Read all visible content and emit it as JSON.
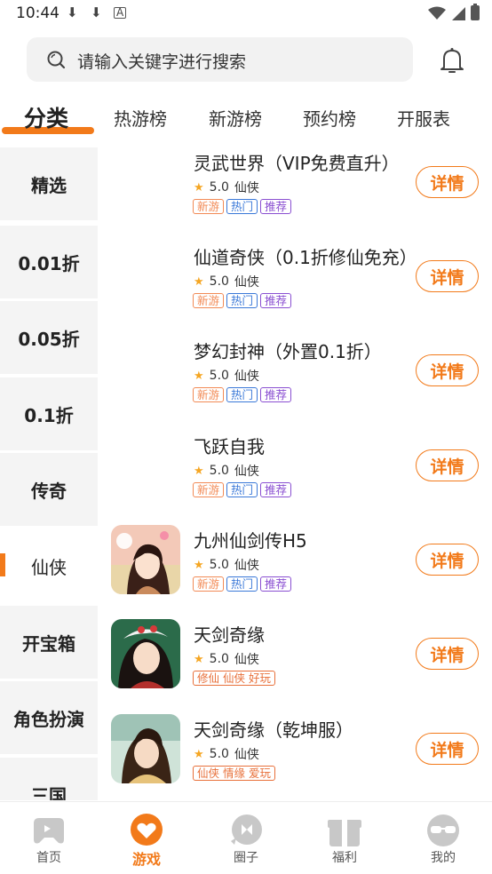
{
  "status_bar": {
    "time": "10:44"
  },
  "search": {
    "placeholder": "请输入关键字进行搜索"
  },
  "tabs": [
    {
      "label": "分类",
      "active": true
    },
    {
      "label": "热游榜"
    },
    {
      "label": "新游榜"
    },
    {
      "label": "预约榜"
    },
    {
      "label": "开服表"
    }
  ],
  "categories": [
    {
      "label": "精选"
    },
    {
      "label": "0.01折"
    },
    {
      "label": "0.05折"
    },
    {
      "label": "0.1折"
    },
    {
      "label": "传奇"
    },
    {
      "label": "仙侠",
      "active": true
    },
    {
      "label": "开宝箱"
    },
    {
      "label": "角色扮演"
    },
    {
      "label": "三国"
    }
  ],
  "games": [
    {
      "title": "灵武世界（VIP免费直升）",
      "rating": "5.0",
      "genre": "仙侠",
      "tags": [
        "新游",
        "热门",
        "推荐"
      ],
      "button": "详情",
      "thumb": "none"
    },
    {
      "title": "仙道奇侠（0.1折修仙免充）",
      "rating": "5.0",
      "genre": "仙侠",
      "tags": [
        "新游",
        "热门",
        "推荐"
      ],
      "button": "详情",
      "thumb": "none"
    },
    {
      "title": "梦幻封神（外置0.1折）",
      "rating": "5.0",
      "genre": "仙侠",
      "tags": [
        "新游",
        "热门",
        "推荐"
      ],
      "button": "详情",
      "thumb": "none"
    },
    {
      "title": "飞跃自我",
      "rating": "5.0",
      "genre": "仙侠",
      "tags": [
        "新游",
        "热门",
        "推荐"
      ],
      "button": "详情",
      "thumb": "none"
    },
    {
      "title": "九州仙剑传H5",
      "rating": "5.0",
      "genre": "仙侠",
      "tags": [
        "新游",
        "热门",
        "推荐"
      ],
      "button": "详情",
      "thumb": "a"
    },
    {
      "title": "天剑奇缘",
      "rating": "5.0",
      "genre": "仙侠",
      "tag_single": "修仙 仙侠 好玩",
      "button": "详情",
      "thumb": "b"
    },
    {
      "title": "天剑奇缘（乾坤服）",
      "rating": "5.0",
      "genre": "仙侠",
      "tag_single": "仙侠 情缘 爱玩",
      "button": "详情",
      "thumb": "c"
    }
  ],
  "bottom_nav": [
    {
      "label": "首页",
      "icon": "gamepad-icon"
    },
    {
      "label": "游戏",
      "icon": "heart-chat-icon",
      "active": true
    },
    {
      "label": "圈子",
      "icon": "bubble-icon"
    },
    {
      "label": "福利",
      "icon": "gift-icon"
    },
    {
      "label": "我的",
      "icon": "face-icon"
    }
  ],
  "colors": {
    "accent": "#f27a1a",
    "star": "#f5a623"
  }
}
